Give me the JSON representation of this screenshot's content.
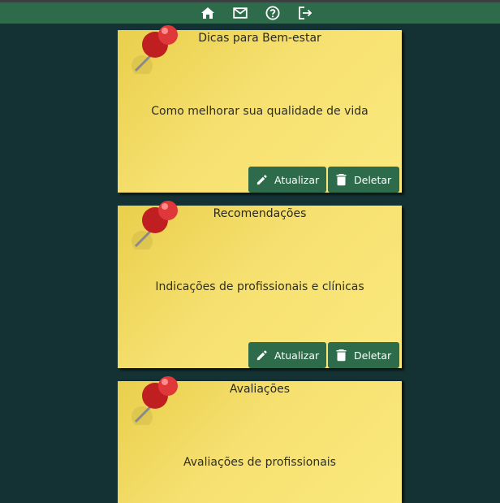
{
  "nav": {
    "icons": [
      "home-icon",
      "mail-icon",
      "help-icon",
      "logout-icon"
    ]
  },
  "colors": {
    "background": "#143233",
    "navbar": "#2e6b4a",
    "note": "#f6e070",
    "button": "#2e6b4a",
    "pin": "#d42a2a"
  },
  "notes": [
    {
      "title": "Dicas para Bem-estar",
      "body": "Como melhorar sua qualidade de vida",
      "update_label": "Atualizar",
      "delete_label": "Deletar"
    },
    {
      "title": "Recomendações",
      "body": "Indicações de profissionais e clínicas",
      "update_label": "Atualizar",
      "delete_label": "Deletar"
    },
    {
      "title": "Avaliações",
      "body": "Avaliações de profissionais"
    }
  ]
}
